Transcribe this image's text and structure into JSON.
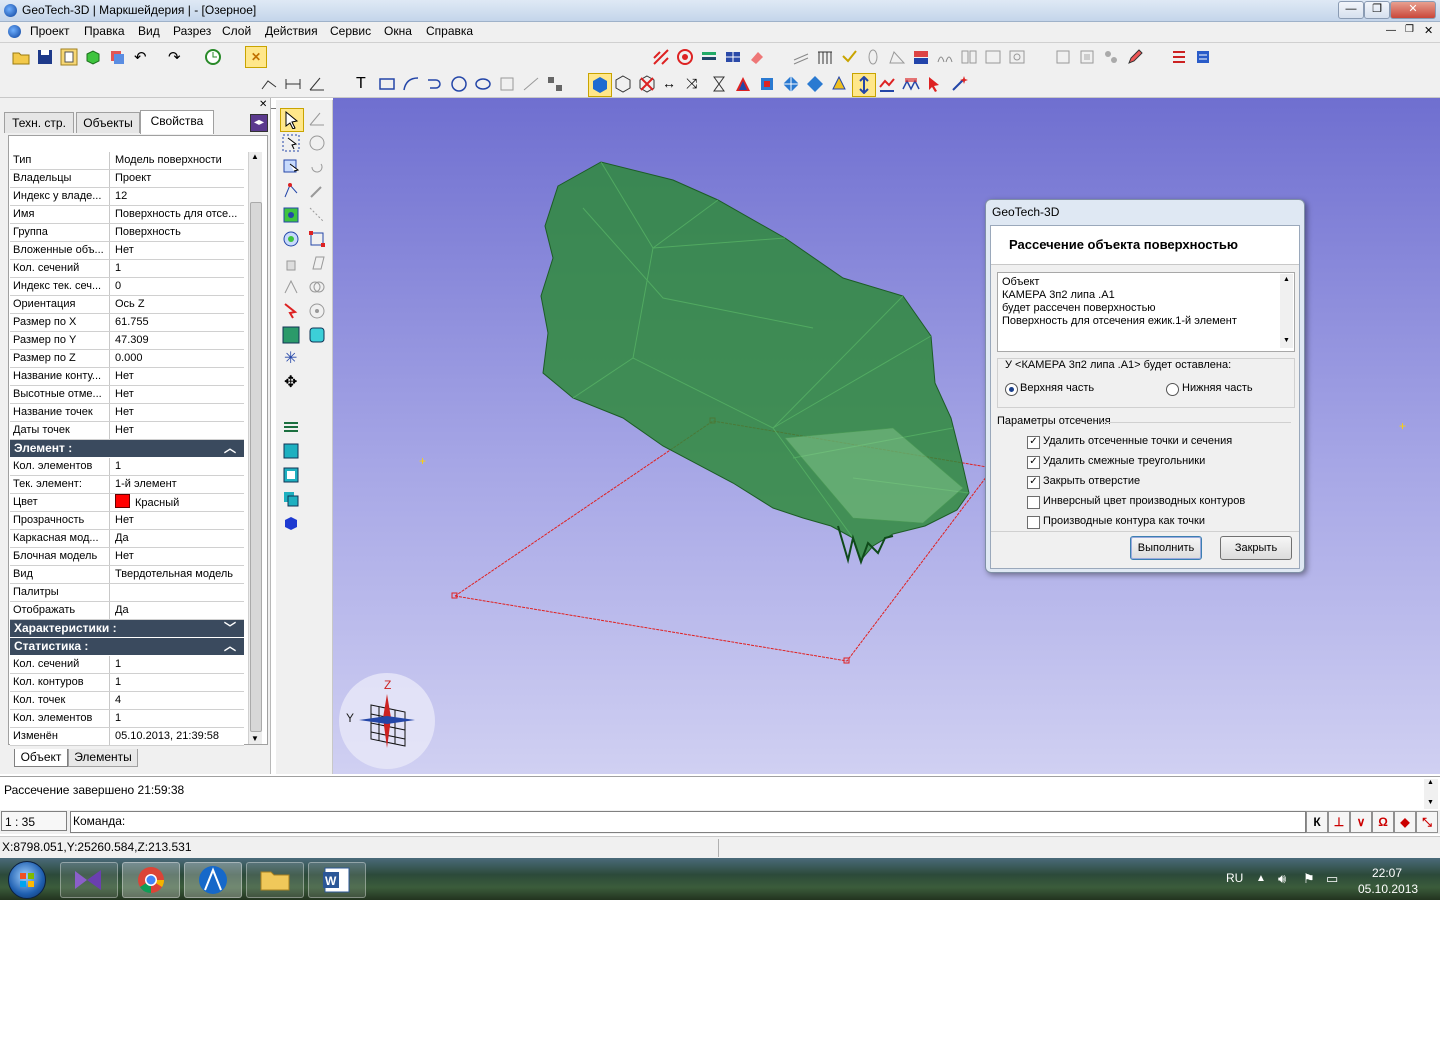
{
  "window": {
    "title": "GeoTech-3D | Маркшейдерия | - [Озерное]",
    "min_label": "—",
    "max_label": "❐",
    "close_label": "✕"
  },
  "menu": [
    "Проект",
    "Правка",
    "Вид",
    "Разрез",
    "Слой",
    "Действия",
    "Сервис",
    "Окна",
    "Справка"
  ],
  "coords": {
    "x_label": "X",
    "y_label": "Y",
    "z_label": "Z",
    "x_value": "",
    "y_value": "",
    "z_value": ""
  },
  "left_tabs": [
    "Техн. стр.",
    "Объекты",
    "Свойства"
  ],
  "properties": [
    {
      "k": "Тип",
      "v": "Модель поверхности"
    },
    {
      "k": "Владельцы",
      "v": "Проект"
    },
    {
      "k": "Индекс у владе...",
      "v": "12"
    },
    {
      "k": "Имя",
      "v": "Поверхность для отсе..."
    },
    {
      "k": "Группа",
      "v": "Поверхность"
    },
    {
      "k": "Вложенные объ...",
      "v": "Нет"
    },
    {
      "k": "Кол. сечений",
      "v": "1"
    },
    {
      "k": "Индекс тек. сеч...",
      "v": "0"
    },
    {
      "k": "Ориентация",
      "v": "Ось Z"
    },
    {
      "k": "Размер по X",
      "v": "61.755"
    },
    {
      "k": "Размер по Y",
      "v": "47.309"
    },
    {
      "k": "Размер по Z",
      "v": "0.000"
    },
    {
      "k": "Название конту...",
      "v": "Нет"
    },
    {
      "k": "Высотные отме...",
      "v": "Нет"
    },
    {
      "k": "Название точек",
      "v": "Нет"
    },
    {
      "k": "Даты точек",
      "v": "Нет"
    }
  ],
  "element_section": "Элемент :",
  "element_props": [
    {
      "k": "Кол. элементов",
      "v": "1"
    },
    {
      "k": "Тек. элемент:",
      "v": "1-й элемент"
    },
    {
      "k": "Цвет",
      "v": "Красный",
      "swatch": "#ff0000"
    },
    {
      "k": "Прозрачность",
      "v": "Нет"
    },
    {
      "k": "Каркасная мод...",
      "v": "Да"
    },
    {
      "k": "Блочная модель",
      "v": "Нет"
    },
    {
      "k": "Вид",
      "v": "Твердотельная модель"
    },
    {
      "k": "Палитры",
      "v": ""
    },
    {
      "k": "Отображать",
      "v": "Да"
    }
  ],
  "char_section": "Характеристики :",
  "stat_section": "Статистика :",
  "stat_props": [
    {
      "k": "Кол. сечений",
      "v": "1"
    },
    {
      "k": "Кол. контуров",
      "v": "1"
    },
    {
      "k": "Кол. точек",
      "v": "4"
    },
    {
      "k": "Кол. элементов",
      "v": "1"
    },
    {
      "k": "Изменён",
      "v": "05.10.2013, 21:39:58"
    }
  ],
  "bottom_tabs": [
    "Объект",
    "Элементы"
  ],
  "axis": {
    "z": "Z",
    "y": "Y"
  },
  "dialog": {
    "title": "GeoTech-3D",
    "heading": "Рассечение объекта поверхностью",
    "info_lines": [
      "Объект",
      "КАМЕРА 3п2 липа .А1",
      "будет рассечен поверхностью",
      "Поверхность для отсечения ежик.1-й элемент"
    ],
    "keep_label": "У <КАМЕРА 3п2 липа .А1> будет оставлена:",
    "radio_upper": "Верхняя часть",
    "radio_lower": "Нижняя часть",
    "params_label": "Параметры отсечения",
    "options": [
      {
        "label": "Удалить отсеченные точки и сечения",
        "checked": true
      },
      {
        "label": "Удалить смежные треугольники",
        "checked": true
      },
      {
        "label": "Закрыть отверстие",
        "checked": true
      },
      {
        "label": "Инверсный цвет производных контуров",
        "checked": false
      },
      {
        "label": "Производные контура как точки",
        "checked": false
      }
    ],
    "run_button": "Выполнить",
    "close_button": "Закрыть"
  },
  "messages": {
    "line": "Рассечение завершено 21:59:38"
  },
  "command": {
    "scale": "1 : 35",
    "label": "Команда:"
  },
  "status": {
    "coords": "X:8798.051,Y:25260.584,Z:213.531"
  },
  "snap_buttons": [
    "К",
    "⊥",
    "∨",
    "Ω",
    "◆",
    "⤡"
  ],
  "taskbar": {
    "lang": "RU",
    "time": "22:07",
    "date": "05.10.2013"
  }
}
